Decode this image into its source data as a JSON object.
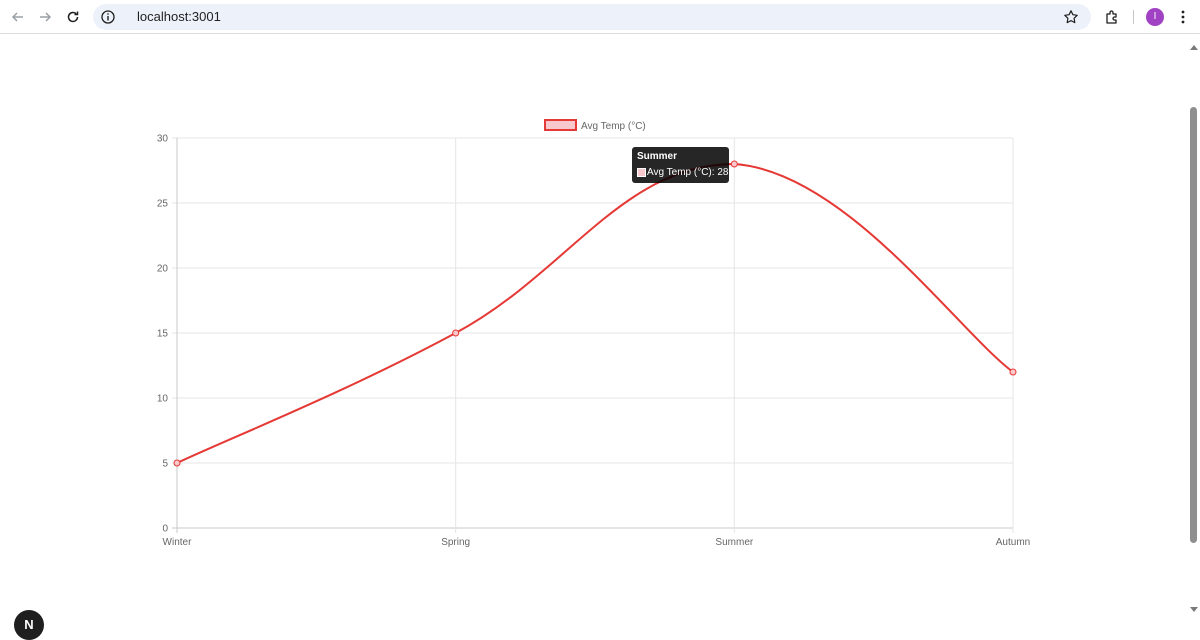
{
  "browser": {
    "url": "localhost:3001",
    "avatar_initial": "I",
    "icons": [
      "back-arrow-icon",
      "forward-arrow-icon",
      "reload-icon",
      "site-info-icon",
      "bookmark-star-icon",
      "extensions-icon",
      "menu-dots-icon"
    ]
  },
  "chart_data": {
    "type": "line",
    "categories": [
      "Winter",
      "Spring",
      "Summer",
      "Autumn"
    ],
    "series": [
      {
        "name": "Avg Temp (°C)",
        "values": [
          5,
          15,
          28,
          12
        ],
        "color": "#e53935",
        "fill": "#f9c8cd"
      }
    ],
    "y_ticks": [
      "0",
      "5",
      "10",
      "15",
      "20",
      "25",
      "30"
    ],
    "ylim": [
      0,
      30
    ],
    "grid": true,
    "legend_position": "top",
    "curve": "smooth"
  },
  "tooltip": {
    "title": "Summer",
    "label": "Avg Temp (°C): 28"
  },
  "dev_badge": {
    "letter": "N"
  }
}
